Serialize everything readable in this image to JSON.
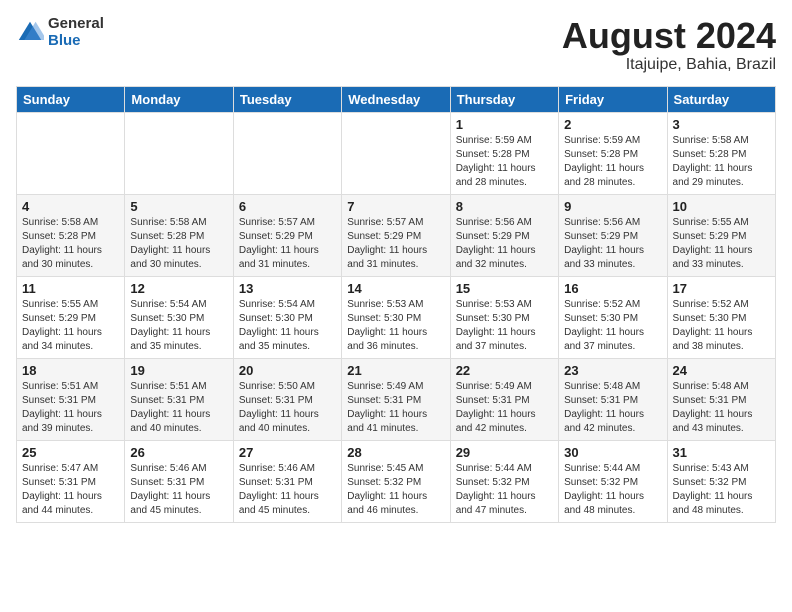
{
  "header": {
    "logo_general": "General",
    "logo_blue": "Blue",
    "title": "August 2024",
    "location": "Itajuipe, Bahia, Brazil"
  },
  "weekdays": [
    "Sunday",
    "Monday",
    "Tuesday",
    "Wednesday",
    "Thursday",
    "Friday",
    "Saturday"
  ],
  "weeks": [
    [
      {
        "day": "",
        "detail": ""
      },
      {
        "day": "",
        "detail": ""
      },
      {
        "day": "",
        "detail": ""
      },
      {
        "day": "",
        "detail": ""
      },
      {
        "day": "1",
        "detail": "Sunrise: 5:59 AM\nSunset: 5:28 PM\nDaylight: 11 hours\nand 28 minutes."
      },
      {
        "day": "2",
        "detail": "Sunrise: 5:59 AM\nSunset: 5:28 PM\nDaylight: 11 hours\nand 28 minutes."
      },
      {
        "day": "3",
        "detail": "Sunrise: 5:58 AM\nSunset: 5:28 PM\nDaylight: 11 hours\nand 29 minutes."
      }
    ],
    [
      {
        "day": "4",
        "detail": "Sunrise: 5:58 AM\nSunset: 5:28 PM\nDaylight: 11 hours\nand 30 minutes."
      },
      {
        "day": "5",
        "detail": "Sunrise: 5:58 AM\nSunset: 5:28 PM\nDaylight: 11 hours\nand 30 minutes."
      },
      {
        "day": "6",
        "detail": "Sunrise: 5:57 AM\nSunset: 5:29 PM\nDaylight: 11 hours\nand 31 minutes."
      },
      {
        "day": "7",
        "detail": "Sunrise: 5:57 AM\nSunset: 5:29 PM\nDaylight: 11 hours\nand 31 minutes."
      },
      {
        "day": "8",
        "detail": "Sunrise: 5:56 AM\nSunset: 5:29 PM\nDaylight: 11 hours\nand 32 minutes."
      },
      {
        "day": "9",
        "detail": "Sunrise: 5:56 AM\nSunset: 5:29 PM\nDaylight: 11 hours\nand 33 minutes."
      },
      {
        "day": "10",
        "detail": "Sunrise: 5:55 AM\nSunset: 5:29 PM\nDaylight: 11 hours\nand 33 minutes."
      }
    ],
    [
      {
        "day": "11",
        "detail": "Sunrise: 5:55 AM\nSunset: 5:29 PM\nDaylight: 11 hours\nand 34 minutes."
      },
      {
        "day": "12",
        "detail": "Sunrise: 5:54 AM\nSunset: 5:30 PM\nDaylight: 11 hours\nand 35 minutes."
      },
      {
        "day": "13",
        "detail": "Sunrise: 5:54 AM\nSunset: 5:30 PM\nDaylight: 11 hours\nand 35 minutes."
      },
      {
        "day": "14",
        "detail": "Sunrise: 5:53 AM\nSunset: 5:30 PM\nDaylight: 11 hours\nand 36 minutes."
      },
      {
        "day": "15",
        "detail": "Sunrise: 5:53 AM\nSunset: 5:30 PM\nDaylight: 11 hours\nand 37 minutes."
      },
      {
        "day": "16",
        "detail": "Sunrise: 5:52 AM\nSunset: 5:30 PM\nDaylight: 11 hours\nand 37 minutes."
      },
      {
        "day": "17",
        "detail": "Sunrise: 5:52 AM\nSunset: 5:30 PM\nDaylight: 11 hours\nand 38 minutes."
      }
    ],
    [
      {
        "day": "18",
        "detail": "Sunrise: 5:51 AM\nSunset: 5:31 PM\nDaylight: 11 hours\nand 39 minutes."
      },
      {
        "day": "19",
        "detail": "Sunrise: 5:51 AM\nSunset: 5:31 PM\nDaylight: 11 hours\nand 40 minutes."
      },
      {
        "day": "20",
        "detail": "Sunrise: 5:50 AM\nSunset: 5:31 PM\nDaylight: 11 hours\nand 40 minutes."
      },
      {
        "day": "21",
        "detail": "Sunrise: 5:49 AM\nSunset: 5:31 PM\nDaylight: 11 hours\nand 41 minutes."
      },
      {
        "day": "22",
        "detail": "Sunrise: 5:49 AM\nSunset: 5:31 PM\nDaylight: 11 hours\nand 42 minutes."
      },
      {
        "day": "23",
        "detail": "Sunrise: 5:48 AM\nSunset: 5:31 PM\nDaylight: 11 hours\nand 42 minutes."
      },
      {
        "day": "24",
        "detail": "Sunrise: 5:48 AM\nSunset: 5:31 PM\nDaylight: 11 hours\nand 43 minutes."
      }
    ],
    [
      {
        "day": "25",
        "detail": "Sunrise: 5:47 AM\nSunset: 5:31 PM\nDaylight: 11 hours\nand 44 minutes."
      },
      {
        "day": "26",
        "detail": "Sunrise: 5:46 AM\nSunset: 5:31 PM\nDaylight: 11 hours\nand 45 minutes."
      },
      {
        "day": "27",
        "detail": "Sunrise: 5:46 AM\nSunset: 5:31 PM\nDaylight: 11 hours\nand 45 minutes."
      },
      {
        "day": "28",
        "detail": "Sunrise: 5:45 AM\nSunset: 5:32 PM\nDaylight: 11 hours\nand 46 minutes."
      },
      {
        "day": "29",
        "detail": "Sunrise: 5:44 AM\nSunset: 5:32 PM\nDaylight: 11 hours\nand 47 minutes."
      },
      {
        "day": "30",
        "detail": "Sunrise: 5:44 AM\nSunset: 5:32 PM\nDaylight: 11 hours\nand 48 minutes."
      },
      {
        "day": "31",
        "detail": "Sunrise: 5:43 AM\nSunset: 5:32 PM\nDaylight: 11 hours\nand 48 minutes."
      }
    ]
  ]
}
